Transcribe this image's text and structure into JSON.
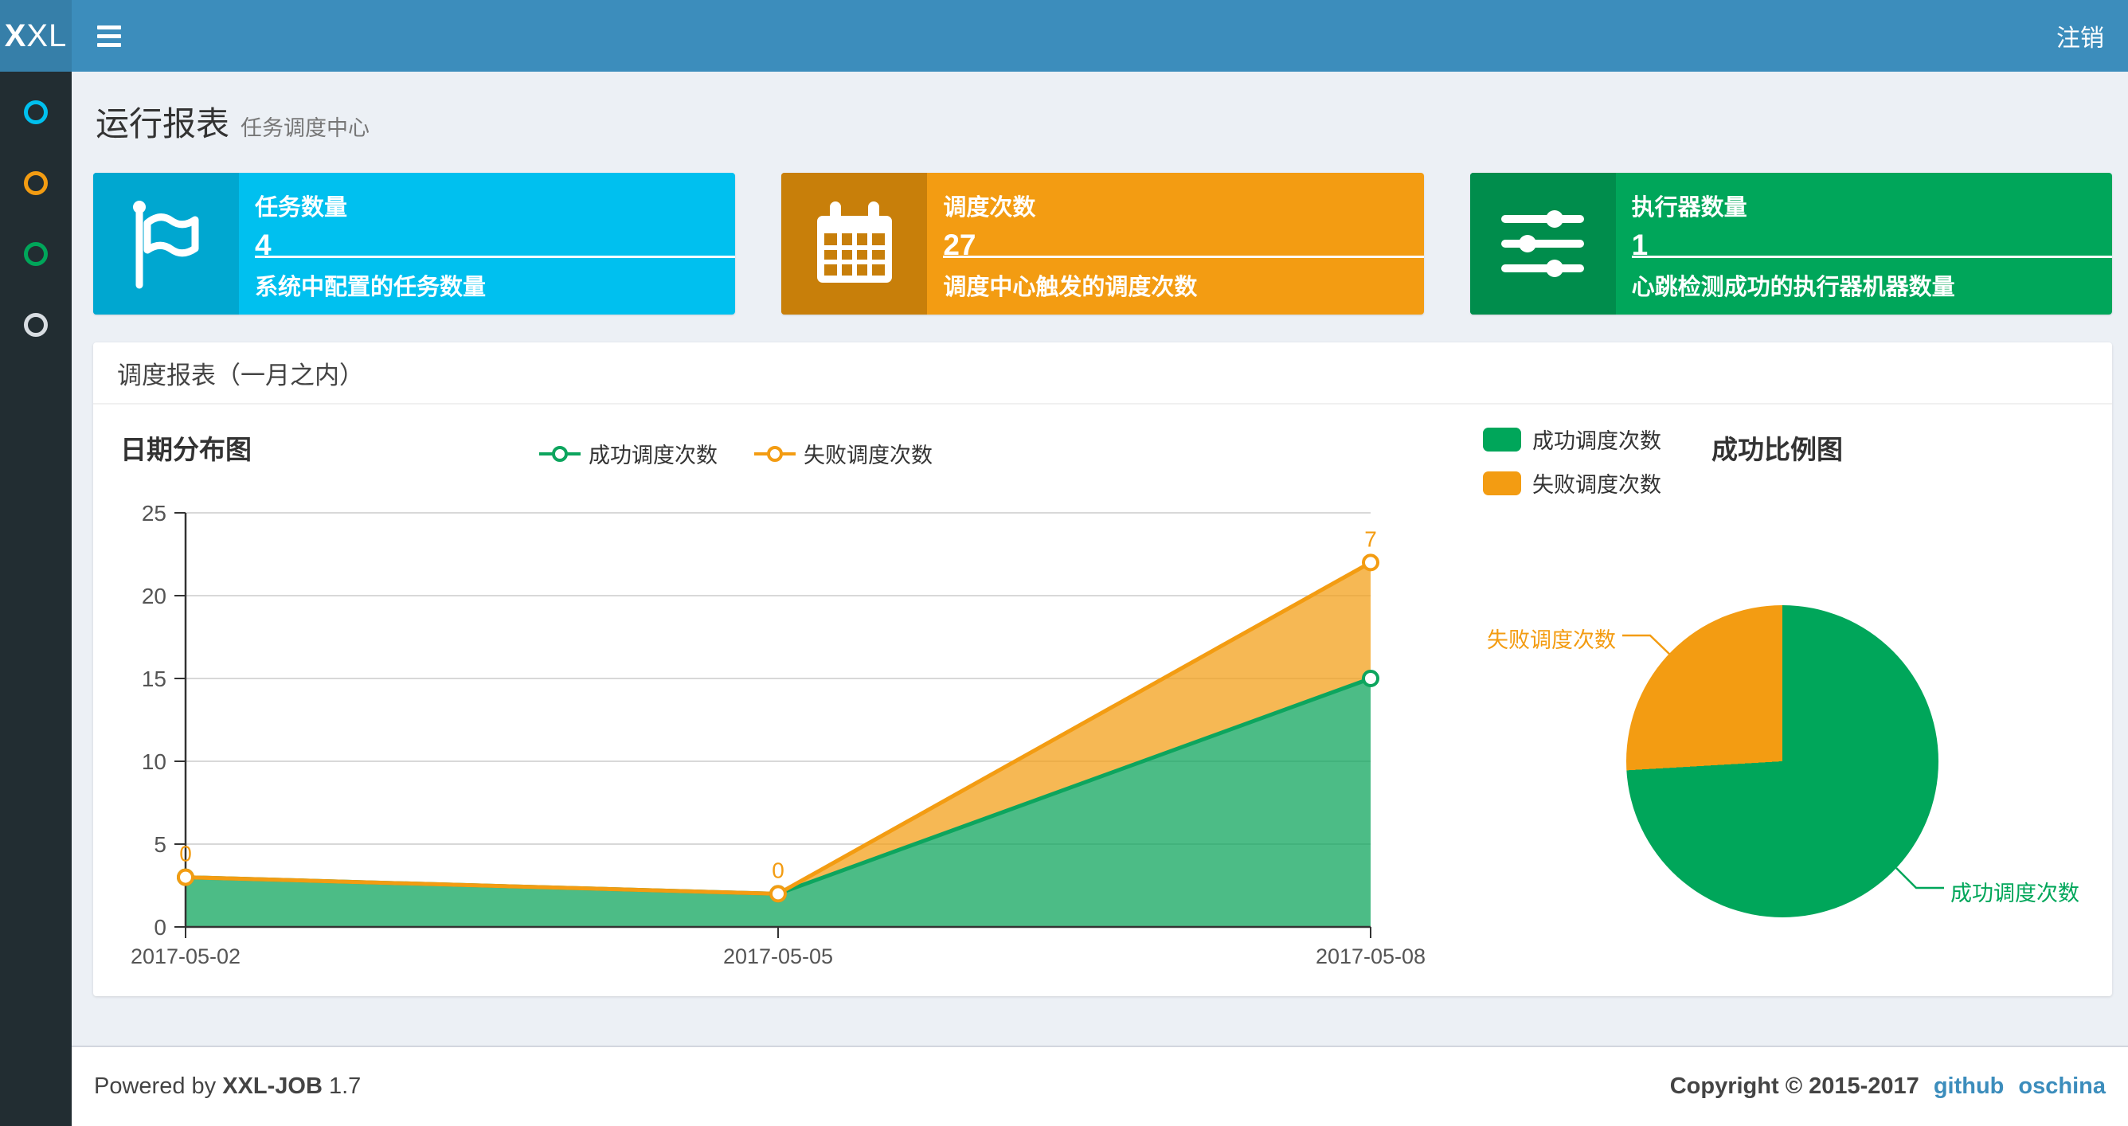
{
  "navbar": {
    "logo_bold": "X",
    "logo_rest": "XL",
    "logout_label": "注销"
  },
  "sidebar": {
    "items": [
      {
        "name": "circle-aqua",
        "color": "#00c0ef"
      },
      {
        "name": "circle-orange",
        "color": "#f39c12"
      },
      {
        "name": "circle-green",
        "color": "#00a65a"
      },
      {
        "name": "circle-white",
        "color": "#d8dde2"
      }
    ]
  },
  "page_header": {
    "title": "运行报表",
    "subtitle": "任务调度中心"
  },
  "info_boxes": [
    {
      "label": "任务数量",
      "value": "4",
      "desc": "系统中配置的任务数量",
      "color": "#00c0ef",
      "icon_color": "#00a7d0",
      "icon": "flag-icon"
    },
    {
      "label": "调度次数",
      "value": "27",
      "desc": "调度中心触发的调度次数",
      "color": "#f39c12",
      "icon_color": "#c87f0a",
      "icon": "calendar-icon"
    },
    {
      "label": "执行器数量",
      "value": "1",
      "desc": "心跳检测成功的执行器机器数量",
      "color": "#00a65a",
      "icon_color": "#008d4c",
      "icon": "sliders-icon"
    }
  ],
  "panel": {
    "title": "调度报表（一月之内）"
  },
  "chart_data": [
    {
      "type": "area",
      "title": "日期分布图",
      "x": [
        "2017-05-02",
        "2017-05-05",
        "2017-05-08"
      ],
      "series": [
        {
          "name": "成功调度次数",
          "values": [
            3,
            2,
            15
          ],
          "color": "#0da55e",
          "fill": "rgba(16,165,94,0.75)",
          "stacked": false,
          "show_labels": false
        },
        {
          "name": "失败调度次数",
          "values": [
            0,
            0,
            7
          ],
          "color": "#f39c12",
          "fill": "rgba(243,156,18,0.72)",
          "stacked": true,
          "show_labels": true,
          "stack_totals": [
            3,
            2,
            22
          ]
        }
      ],
      "ylim": [
        0,
        25
      ],
      "yticks": [
        0,
        5,
        10,
        15,
        20,
        25
      ],
      "grid": true,
      "legend_position": "top-center",
      "axis_color": "#333333",
      "grid_color": "#cccccc",
      "tick_label_color": "#555555"
    },
    {
      "type": "pie",
      "title": "成功比例图",
      "slices": [
        {
          "label": "成功调度次数",
          "value": 20,
          "color": "#00a65a"
        },
        {
          "label": "失败调度次数",
          "value": 7,
          "color": "#f39c12"
        }
      ],
      "legend_position": "top-left"
    }
  ],
  "footer": {
    "powered_prefix": "Powered by",
    "brand": "XXL-JOB",
    "version": "1.7",
    "copyright": "Copyright © 2015-2017",
    "links": [
      {
        "label": "github"
      },
      {
        "label": "oschina"
      }
    ]
  }
}
